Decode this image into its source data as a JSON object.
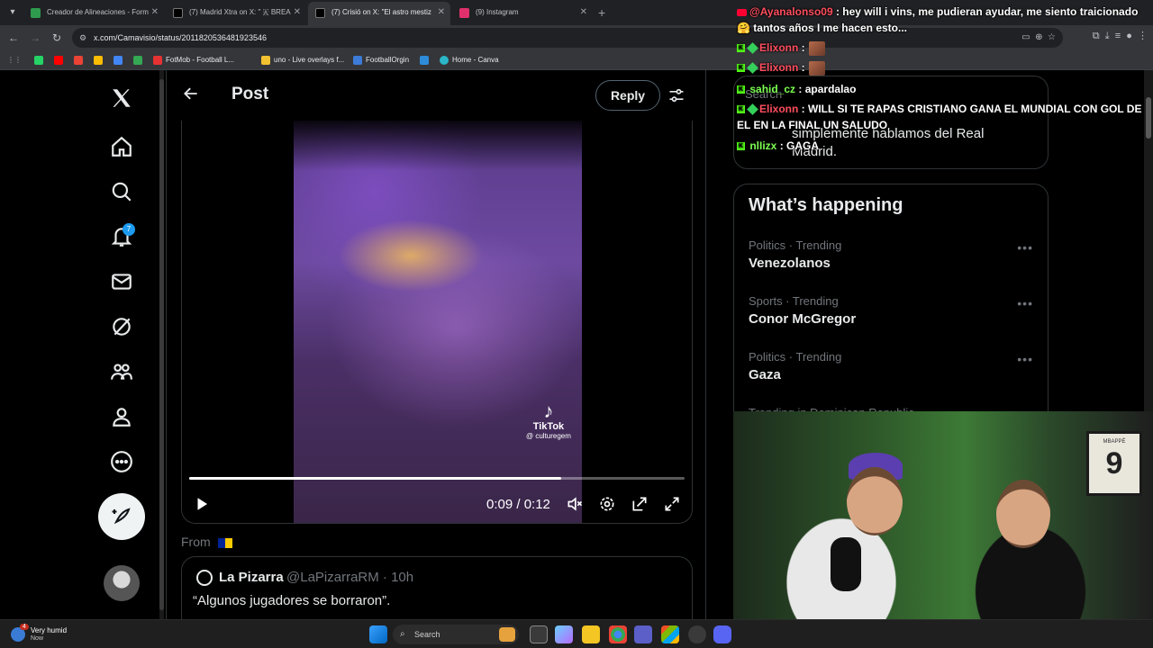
{
  "browser": {
    "tabs": [
      {
        "label": "Creador de Alineaciones - Form",
        "color": "#2e9b4f"
      },
      {
        "label": "(7) Madrid Xtra on X: \" 🇦 BREA",
        "color": "#000000"
      },
      {
        "label": "(7) Crisió on X: \"El astro mestiz",
        "color": "#000000"
      },
      {
        "label": "(9) Instagram",
        "color": "#e1306c"
      }
    ],
    "url": "x.com/Camavisio/status/2011820536481923546",
    "bookmarks": [
      {
        "label": "FotMob - Football L...",
        "color": "#e63232"
      },
      {
        "label": "uno - Live overlays f...",
        "color": "#f2c230"
      },
      {
        "label": "FootballOrgin",
        "color": "#3d7bd9"
      },
      {
        "label": "Home - Canva",
        "color": "#2bb5c8"
      }
    ]
  },
  "x": {
    "nav": {
      "notifications_count": "7"
    },
    "header": {
      "title": "Post",
      "reply_label": "Reply"
    },
    "video": {
      "time": "0:09 / 0:12",
      "progress": 0.75,
      "watermark_brand": "TikTok",
      "watermark_user": "@ culturegem"
    },
    "from_label": "From",
    "quote": {
      "name": "La Pizarra",
      "handle": "@LaPizarraRM · 10h",
      "text": "“Algunos jugadores se borraron”."
    },
    "right": {
      "search_placeholder": "Search",
      "search_snippet": "simplemente hablamos del Real Madrid.",
      "happening_title": "What’s happening",
      "trends": [
        {
          "meta": "Politics · Trending",
          "name": "Venezolanos"
        },
        {
          "meta": "Sports · Trending",
          "name": "Conor McGregor"
        },
        {
          "meta": "Politics · Trending",
          "name": "Gaza"
        }
      ],
      "partial_trend": "Trending in Dominican Republic"
    }
  },
  "chat": [
    {
      "platform": "youtube",
      "user": "@Ayanalonso09",
      "text": "hey will i vins, me pudieran ayudar, me siento traicionado🤗 tantos años I me hacen esto...",
      "user_color": "#ff4d5e"
    },
    {
      "platform": "kick",
      "user": "Elixonn",
      "text": "",
      "user_color": "#ff4d5e",
      "emote": true
    },
    {
      "platform": "kick",
      "user": "Elixonn",
      "text": "",
      "user_color": "#ff4d5e",
      "emote": true
    },
    {
      "platform": "kick",
      "user": "sahid_cz",
      "text": "apardalao",
      "user_color": "#7cff52"
    },
    {
      "platform": "kick",
      "user": "Elixonn",
      "text": "WILL SI TE RAPAS CRISTIANO GANA EL MUNDIAL CON GOL DE EL EN LA FINAL UN SALUDO",
      "user_color": "#ff4d5e"
    },
    {
      "platform": "kick",
      "user": "nlIizx",
      "text": "GAGA",
      "user_color": "#7cff52"
    }
  ],
  "webcam": {
    "jersey_name": "MBAPPÉ",
    "jersey_number": "9"
  },
  "taskbar": {
    "weather_title": "Very humid",
    "weather_sub": "Now",
    "weather_badge": "4",
    "search_label": "Search"
  }
}
